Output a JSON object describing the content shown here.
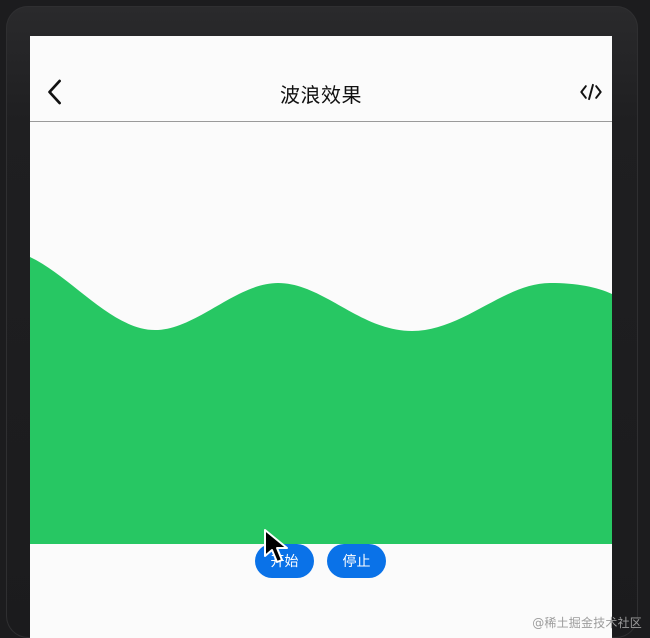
{
  "header": {
    "title": "波浪效果"
  },
  "buttons": {
    "start_label": "开始",
    "stop_label": "停止"
  },
  "watermark": "@稀土掘金技术社区",
  "icons": {
    "back": "back-icon",
    "code": "code-icon",
    "cursor": "cursor-icon"
  },
  "colors": {
    "wave": "#27c763",
    "button": "#0a72e8",
    "page_background": "#fbfbfb"
  }
}
